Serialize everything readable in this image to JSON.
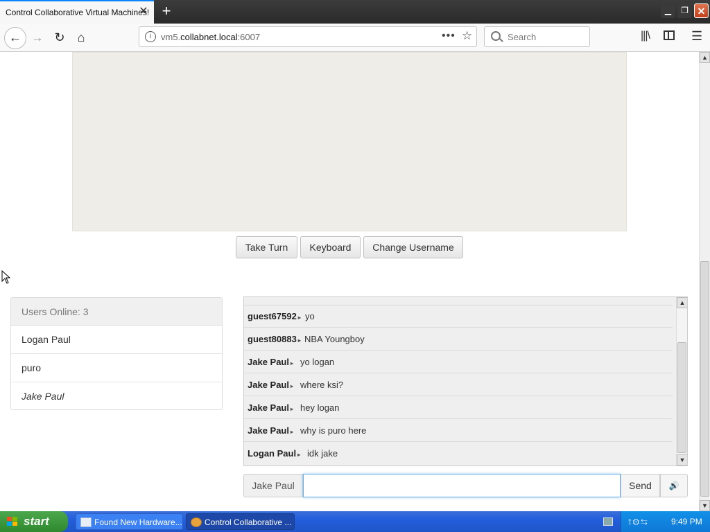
{
  "browser": {
    "tab_title": "Control Collaborative Virtual Machines!",
    "tab_close": "✕",
    "new_tab": "+",
    "url_prefix": "vm5.",
    "url_host": "collabnet.local",
    "url_port": ":6007",
    "search_placeholder": "Search"
  },
  "vm_controls": {
    "take_turn": "Take Turn",
    "keyboard": "Keyboard",
    "change_username": "Change Username"
  },
  "users": {
    "header": "Users Online: 3",
    "list": [
      "Logan Paul",
      "puro",
      "Jake Paul"
    ]
  },
  "chat": {
    "messages": [
      {
        "user": "guest67592",
        "text": "yo"
      },
      {
        "user": "guest80883",
        "text": "NBA Youngboy"
      },
      {
        "user": "Jake Paul",
        "text": "yo logan"
      },
      {
        "user": "Jake Paul",
        "text": "where ksi?"
      },
      {
        "user": "Jake Paul",
        "text": "hey logan"
      },
      {
        "user": "Jake Paul",
        "text": "why is puro here"
      },
      {
        "user": "Logan Paul",
        "text": "idk jake"
      }
    ],
    "username": "Jake Paul",
    "input_value": "",
    "send": "Send"
  },
  "taskbar": {
    "start": "start",
    "items": [
      "Found New Hardware...",
      "Control Collaborative ..."
    ],
    "clock": "9:49 PM"
  }
}
